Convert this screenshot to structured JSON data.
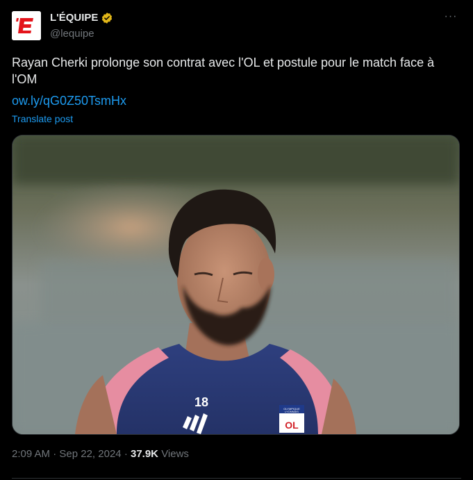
{
  "author": {
    "display_name": "L'ÉQUIPE",
    "handle": "@lequipe",
    "verified": true,
    "avatar_letter": "E",
    "avatar_color": "#e4141b"
  },
  "tweet": {
    "text": "Rayan Cherki prolonge son contrat avec l'OL et postule pour le match face à l'OM",
    "link": "ow.ly/qG0Z50TsmHx",
    "translate_label": "Translate post"
  },
  "media": {
    "jersey_number": "18",
    "crest_text_top": "OLYMPIQUE",
    "crest_text_bottom": "LYONNAIS",
    "crest_letters": "OL"
  },
  "meta": {
    "time": "2:09 AM",
    "separator": "·",
    "date": "Sep 22, 2024",
    "views_count": "37.9K",
    "views_label": "Views"
  },
  "colors": {
    "background": "#000000",
    "text": "#e7e9ea",
    "muted": "#71767b",
    "link": "#1d9bf0",
    "verified_gold": "#e2b719"
  }
}
